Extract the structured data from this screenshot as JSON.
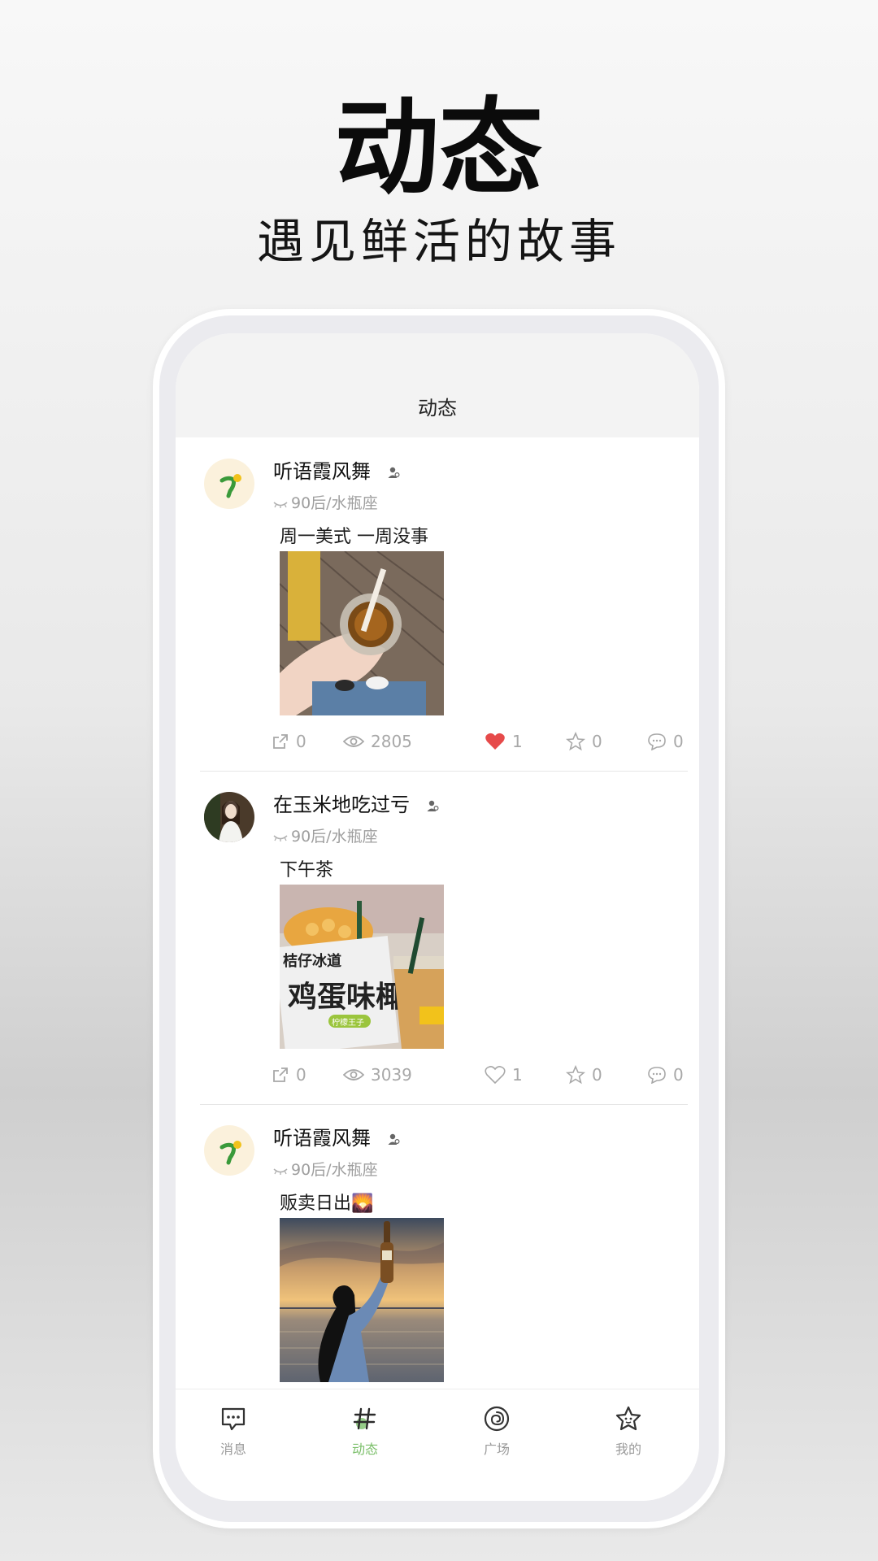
{
  "promo": {
    "title": "动态",
    "subtitle": "遇见鲜活的故事"
  },
  "header": {
    "title": "动态"
  },
  "posts": [
    {
      "username": "听语霞风舞",
      "meta": "90后/水瓶座",
      "caption": "周一美式 一周没事",
      "shares": "0",
      "views": "2805",
      "likes": "1",
      "liked": true,
      "favorites": "0",
      "comments": "0"
    },
    {
      "username": "在玉米地吃过亏",
      "meta": "90后/水瓶座",
      "caption": "下午茶",
      "shares": "0",
      "views": "3039",
      "likes": "1",
      "liked": false,
      "favorites": "0",
      "comments": "0",
      "photo_text": {
        "line1": "桔仔冰道",
        "line2": "鸡蛋味椰",
        "badge": "柠檬王子"
      }
    },
    {
      "username": "听语霞风舞",
      "meta": "90后/水瓶座",
      "caption": "贩卖日出🌄"
    }
  ],
  "tabs": [
    {
      "label": "消息",
      "icon": "message-icon"
    },
    {
      "label": "动态",
      "icon": "hashtag-icon",
      "active": true
    },
    {
      "label": "广场",
      "icon": "plaza-spiral-icon"
    },
    {
      "label": "我的",
      "icon": "star-face-icon"
    }
  ],
  "colors": {
    "accent": "#7bbf6a",
    "like_red": "#e64a4a",
    "muted": "#a8a8a8",
    "header_bg": "#f3f3f3"
  }
}
